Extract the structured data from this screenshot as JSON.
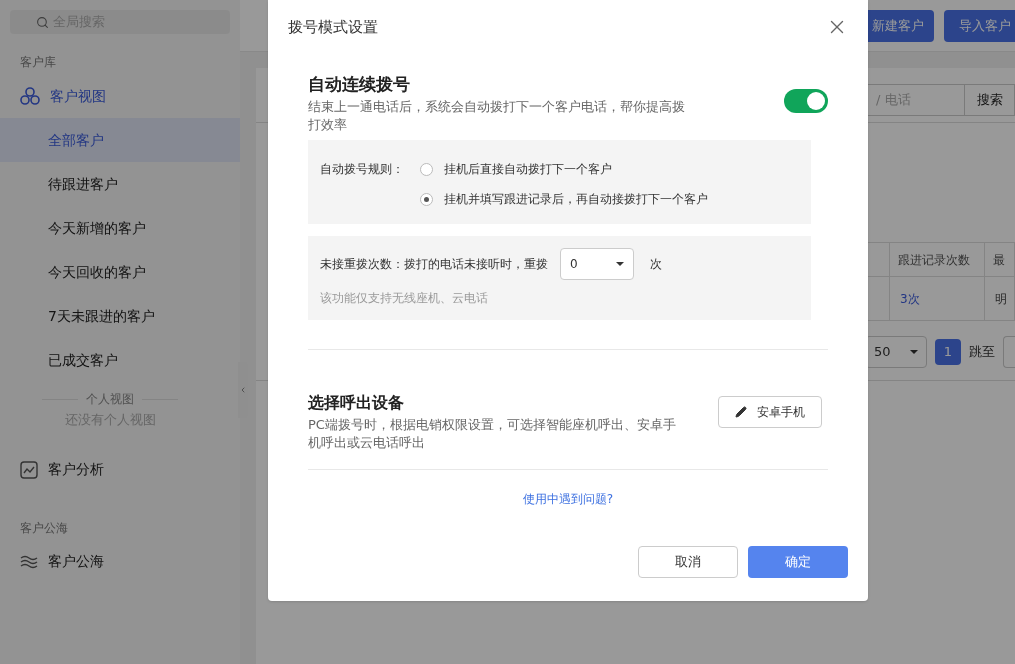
{
  "sidebar": {
    "search": {
      "placeholder": "全局搜索"
    },
    "sections": [
      {
        "title": "客户库",
        "groups": [
          {
            "label": "客户视图",
            "items": [
              {
                "label": "全部客户",
                "selected": true
              },
              {
                "label": "待跟进客户",
                "selected": false
              },
              {
                "label": "今天新增的客户",
                "selected": false
              },
              {
                "label": "今天回收的客户",
                "selected": false
              },
              {
                "label": "7天未跟进的客户",
                "selected": false
              },
              {
                "label": "已成交客户",
                "selected": false
              }
            ],
            "personal": {
              "title": "个人视图",
              "empty": "还没有个人视图"
            }
          },
          {
            "label": "客户分析"
          }
        ]
      },
      {
        "title": "客户公海",
        "groups": [
          {
            "label": "客户公海"
          }
        ]
      }
    ]
  },
  "main": {
    "new_button": {
      "label": "新建客户"
    },
    "import_button": "导入客户",
    "search": {
      "placeholder": "/ 电话",
      "button": "搜索"
    },
    "table": {
      "columns": [
        "跟进记录次数",
        "最"
      ],
      "rows": [
        [
          "3次",
          "明"
        ]
      ]
    },
    "pagination": {
      "page_size": "50",
      "pages": [
        {
          "label": "1",
          "selected": true
        }
      ],
      "jump": "跳至"
    }
  },
  "dialog": {
    "title": "拨号模式设置",
    "auto_dial": {
      "title": "自动连续拨号",
      "description": "结束上一通电话后，系统会自动拨打下一个客户电话，帮你提高拨打效率",
      "on": true,
      "rule_label": "自动拨号规则：",
      "rules": [
        {
          "label": "挂机后直接自动拨打下一个客户",
          "selected": false
        },
        {
          "label": "挂机并填写跟进记录后，再自动接拨打下一个客户",
          "selected": true
        }
      ],
      "redial_label": "未接重拨次数：拨打的电话未接听时，重拨",
      "redial_value": "0",
      "redial_unit": "次",
      "note": "该功能仅支持无线座机、云电话"
    },
    "device": {
      "title": "选择呼出设备",
      "description": "PC端拨号时，根据电销权限设置，可选择智能座机呼出、安卓手机呼出或云电话呼出",
      "button": "安卓手机"
    },
    "help_link": "使用中遇到问题?",
    "buttons": {
      "cancel": "取消",
      "ok": "确定"
    }
  }
}
